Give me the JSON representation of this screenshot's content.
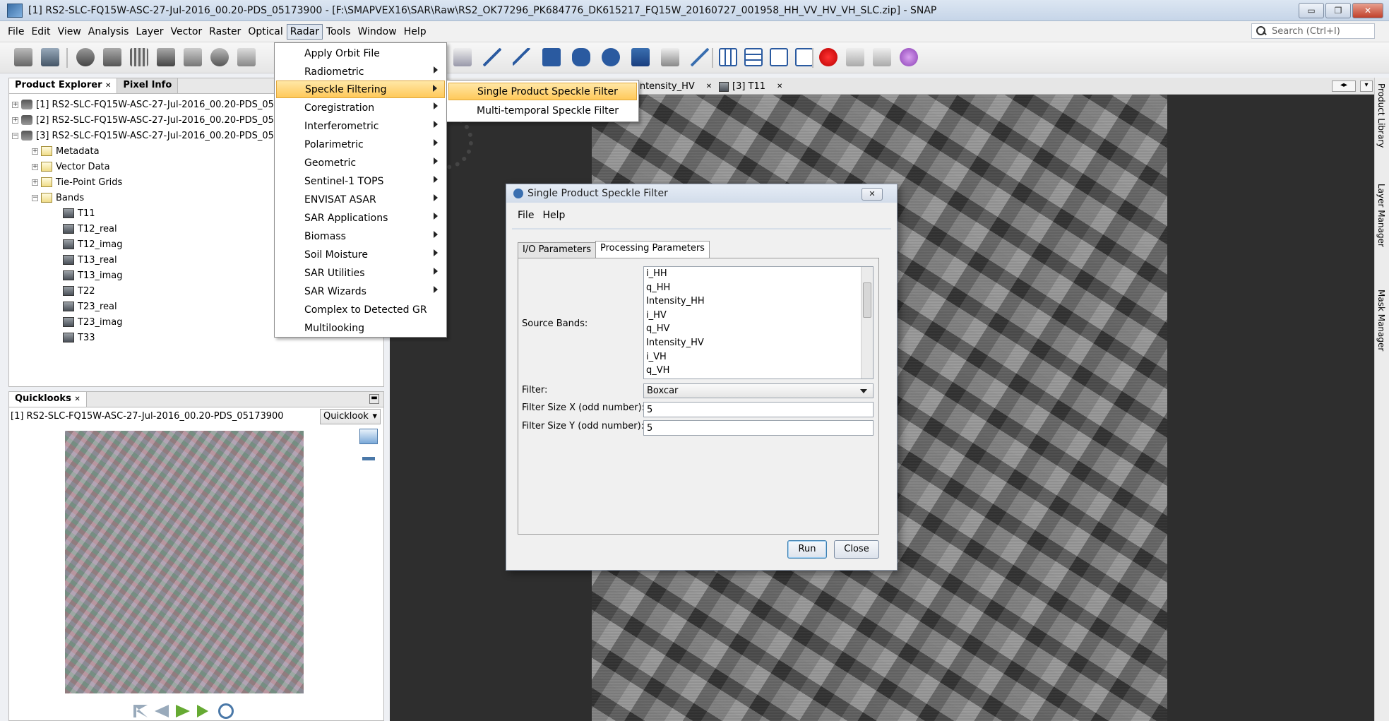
{
  "window": {
    "title": "[1] RS2-SLC-FQ15W-ASC-27-Jul-2016_00.20-PDS_05173900 - [F:\\SMAPVEX16\\SAR\\Raw\\RS2_OK77296_PK684776_DK615217_FQ15W_20160727_001958_HH_VV_HV_VH_SLC.zip] - SNAP",
    "minimize": "▭",
    "restore": "❐",
    "close": "✕"
  },
  "menubar": [
    "File",
    "Edit",
    "View",
    "Analysis",
    "Layer",
    "Vector",
    "Raster",
    "Optical",
    "Radar",
    "Tools",
    "Window",
    "Help"
  ],
  "search": {
    "placeholder": "Search (Ctrl+I)"
  },
  "product_explorer": {
    "tab_label": "Product Explorer",
    "tab_close": "✕",
    "pixel_info_label": "Pixel Info",
    "products": [
      "[1] RS2-SLC-FQ15W-ASC-27-Jul-2016_00.20-PDS_05",
      "[2] RS2-SLC-FQ15W-ASC-27-Jul-2016_00.20-PDS_05",
      "[3] RS2-SLC-FQ15W-ASC-27-Jul-2016_00.20-PDS_05"
    ],
    "folders": [
      "Metadata",
      "Vector Data",
      "Tie-Point Grids",
      "Bands"
    ],
    "bands": [
      "T11",
      "T12_real",
      "T12_imag",
      "T13_real",
      "T13_imag",
      "T22",
      "T23_real",
      "T23_imag",
      "T33"
    ]
  },
  "quicklooks": {
    "tab_label": "Quicklooks",
    "product": "[1] RS2-SLC-FQ15W-ASC-27-Jul-2016_00.20-PDS_05173900",
    "dropdown": "Quicklook"
  },
  "image_tabs": [
    "Intensity_HV",
    "[3] T11"
  ],
  "radar_menu": {
    "items": [
      {
        "label": "Apply Orbit File",
        "submenu": false
      },
      {
        "label": "Radiometric",
        "submenu": true
      },
      {
        "label": "Speckle Filtering",
        "submenu": true,
        "selected": true
      },
      {
        "label": "Coregistration",
        "submenu": true
      },
      {
        "label": "Interferometric",
        "submenu": true
      },
      {
        "label": "Polarimetric",
        "submenu": true
      },
      {
        "label": "Geometric",
        "submenu": true
      },
      {
        "label": "Sentinel-1 TOPS",
        "submenu": true
      },
      {
        "label": "ENVISAT ASAR",
        "submenu": true
      },
      {
        "label": "SAR Applications",
        "submenu": true
      },
      {
        "label": "Biomass",
        "submenu": true
      },
      {
        "label": "Soil Moisture",
        "submenu": true
      },
      {
        "label": "SAR Utilities",
        "submenu": true
      },
      {
        "label": "SAR Wizards",
        "submenu": true
      },
      {
        "label": "Complex to Detected GR",
        "submenu": false
      },
      {
        "label": "Multilooking",
        "submenu": false
      }
    ]
  },
  "speckle_submenu": {
    "items": [
      "Single Product Speckle Filter",
      "Multi-temporal Speckle Filter"
    ]
  },
  "dialog": {
    "title": "Single Product Speckle Filter",
    "close": "✕",
    "menu": [
      "File",
      "Help"
    ],
    "tabs": [
      "I/O Parameters",
      "Processing Parameters"
    ],
    "source_bands_label": "Source Bands:",
    "source_bands": [
      "i_HH",
      "q_HH",
      "Intensity_HH",
      "i_HV",
      "q_HV",
      "Intensity_HV",
      "i_VH",
      "q_VH"
    ],
    "filter_label": "Filter:",
    "filter_value": "Boxcar",
    "size_x_label": "Filter Size X (odd number):",
    "size_x_value": "5",
    "size_y_label": "Filter Size Y (odd number):",
    "size_y_value": "5",
    "run_label": "Run",
    "close_label": "Close"
  },
  "right_dock": [
    "Product Library",
    "Layer Manager",
    "Mask Manager"
  ],
  "colors": {
    "menu_highlight": "#ffc95a",
    "accent": "#3a6fb0"
  }
}
